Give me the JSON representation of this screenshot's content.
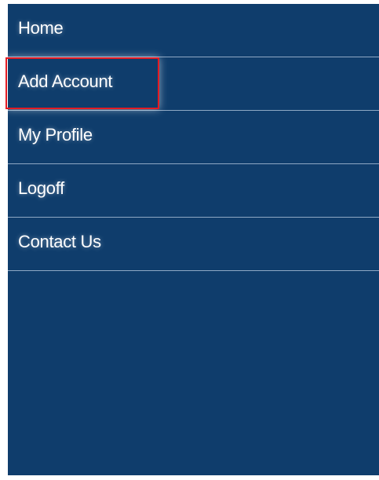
{
  "nav": {
    "items": [
      {
        "label": "Home"
      },
      {
        "label": "Add Account",
        "highlighted": true
      },
      {
        "label": "My Profile"
      },
      {
        "label": "Logoff"
      },
      {
        "label": "Contact Us"
      }
    ]
  },
  "colors": {
    "panel_background": "#0f3d6c",
    "divider": "#8ea8c4",
    "text": "#ffffff",
    "highlight_border": "#e31b23"
  }
}
